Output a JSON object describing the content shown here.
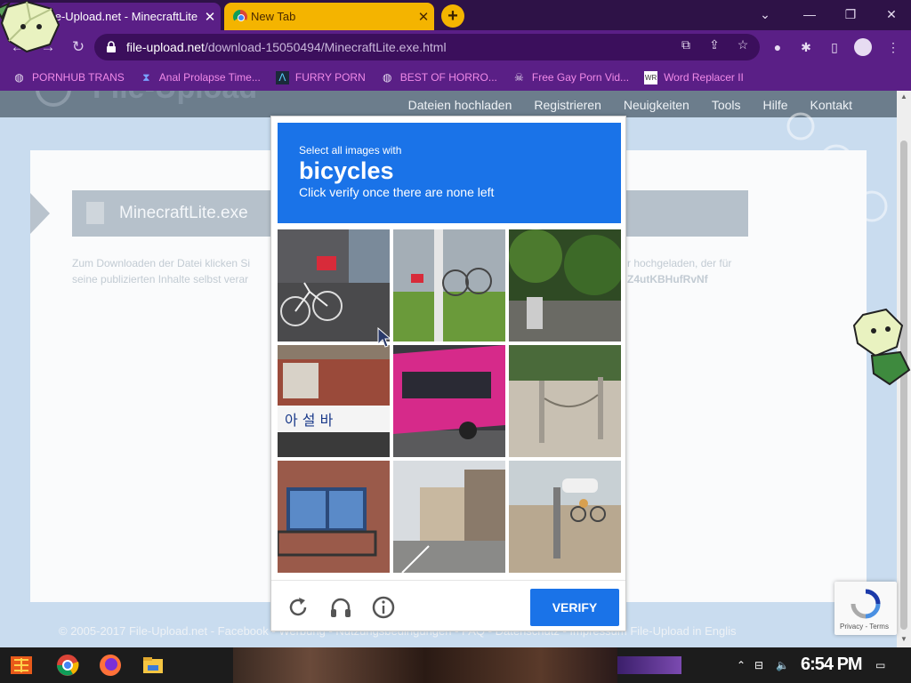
{
  "browser": {
    "tabs": [
      {
        "title": "File-Upload.net - MinecraftLite",
        "active": true
      },
      {
        "title": "New Tab",
        "active": false
      }
    ],
    "new_tab_label": "+",
    "window_controls": {
      "chevron": "⌄",
      "minimize": "—",
      "restore": "❐",
      "close": "✕"
    },
    "url_host": "file-upload.net",
    "url_path": "/download-15050494/MinecraftLite.exe.html",
    "accent": "#5a1f86",
    "tab_accent": "#f4b400"
  },
  "bookmarks": [
    {
      "label": "PORNHUB TRANS",
      "icon": "globe-icon"
    },
    {
      "label": "Anal Prolapse Time...",
      "icon": "bookmark-icon"
    },
    {
      "label": "FURRY PORN",
      "icon": "lambda-icon"
    },
    {
      "label": "BEST OF HORRO...",
      "icon": "globe-icon"
    },
    {
      "label": "Free Gay Porn Vid...",
      "icon": "skull-icon"
    },
    {
      "label": "Word Replacer II",
      "icon": "wr-icon"
    }
  ],
  "site": {
    "nav": [
      "Dateien hochladen",
      "Registrieren",
      "Neuigkeiten",
      "Tools",
      "Hilfe",
      "Kontakt"
    ],
    "logo": "File-Upload",
    "file_name": "MinecraftLite.exe",
    "download_text_left_1": "Zum Downloaden der Datei klicken Si",
    "download_text_left_2": "seine publizierten Inhalte selbst verar",
    "download_text_right": "r hochgeladen, der für",
    "download_code": "Z4utKBHufRvNf",
    "footer": "© 2005-2017 File-Upload.net  -  Facebook  -  Werbung  -  Nutzungsbedingungen  -  FAQ  -  Datenschutz  -  Impressum     File-Upload in Englis"
  },
  "captcha": {
    "select_text": "Select all images with",
    "target": "bicycles",
    "help_text": "Click verify once there are none left",
    "verify_label": "VERIFY",
    "tiles": [
      "tile-bicycles-parked",
      "tile-bicycle-at-station",
      "tile-trees-driveway",
      "tile-storefront-sign",
      "tile-pink-bus",
      "tile-bollards",
      "tile-balcony",
      "tile-street-corner",
      "tile-cyclist-lot"
    ],
    "accent": "#1a73e8"
  },
  "recaptcha_badge": {
    "links": "Privacy - Terms"
  },
  "taskbar": {
    "clock": "6:54 PM"
  }
}
